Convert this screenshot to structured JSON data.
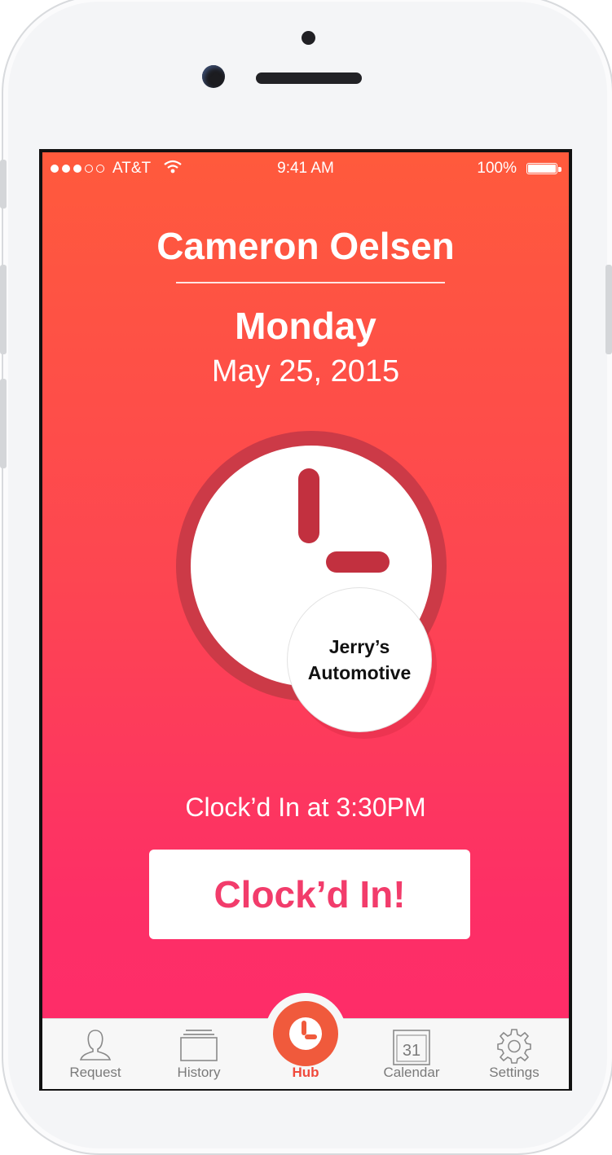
{
  "status_bar": {
    "carrier": "AT&T",
    "time": "9:41 AM",
    "battery": "100%"
  },
  "header": {
    "name": "Cameron Oelsen",
    "day": "Monday",
    "date": "May 25, 2015"
  },
  "clock": {
    "icon": "clock-icon",
    "location_line1": "Jerry’s",
    "location_line2": "Automotive"
  },
  "status_text": "Clock’d In at 3:30PM",
  "primary_button": "Clock’d In!",
  "tabs": [
    {
      "label": "Request",
      "icon": "person-icon"
    },
    {
      "label": "History",
      "icon": "history-icon"
    },
    {
      "label": "Hub",
      "icon": "clock-icon"
    },
    {
      "label": "Calendar",
      "icon": "calendar-icon",
      "badge": "31"
    },
    {
      "label": "Settings",
      "icon": "gear-icon"
    }
  ],
  "colors": {
    "gradient_top": "#ff5a3c",
    "gradient_bottom": "#fe2b6a",
    "accent": "#f04a3c",
    "button_text": "#f23c6b"
  }
}
